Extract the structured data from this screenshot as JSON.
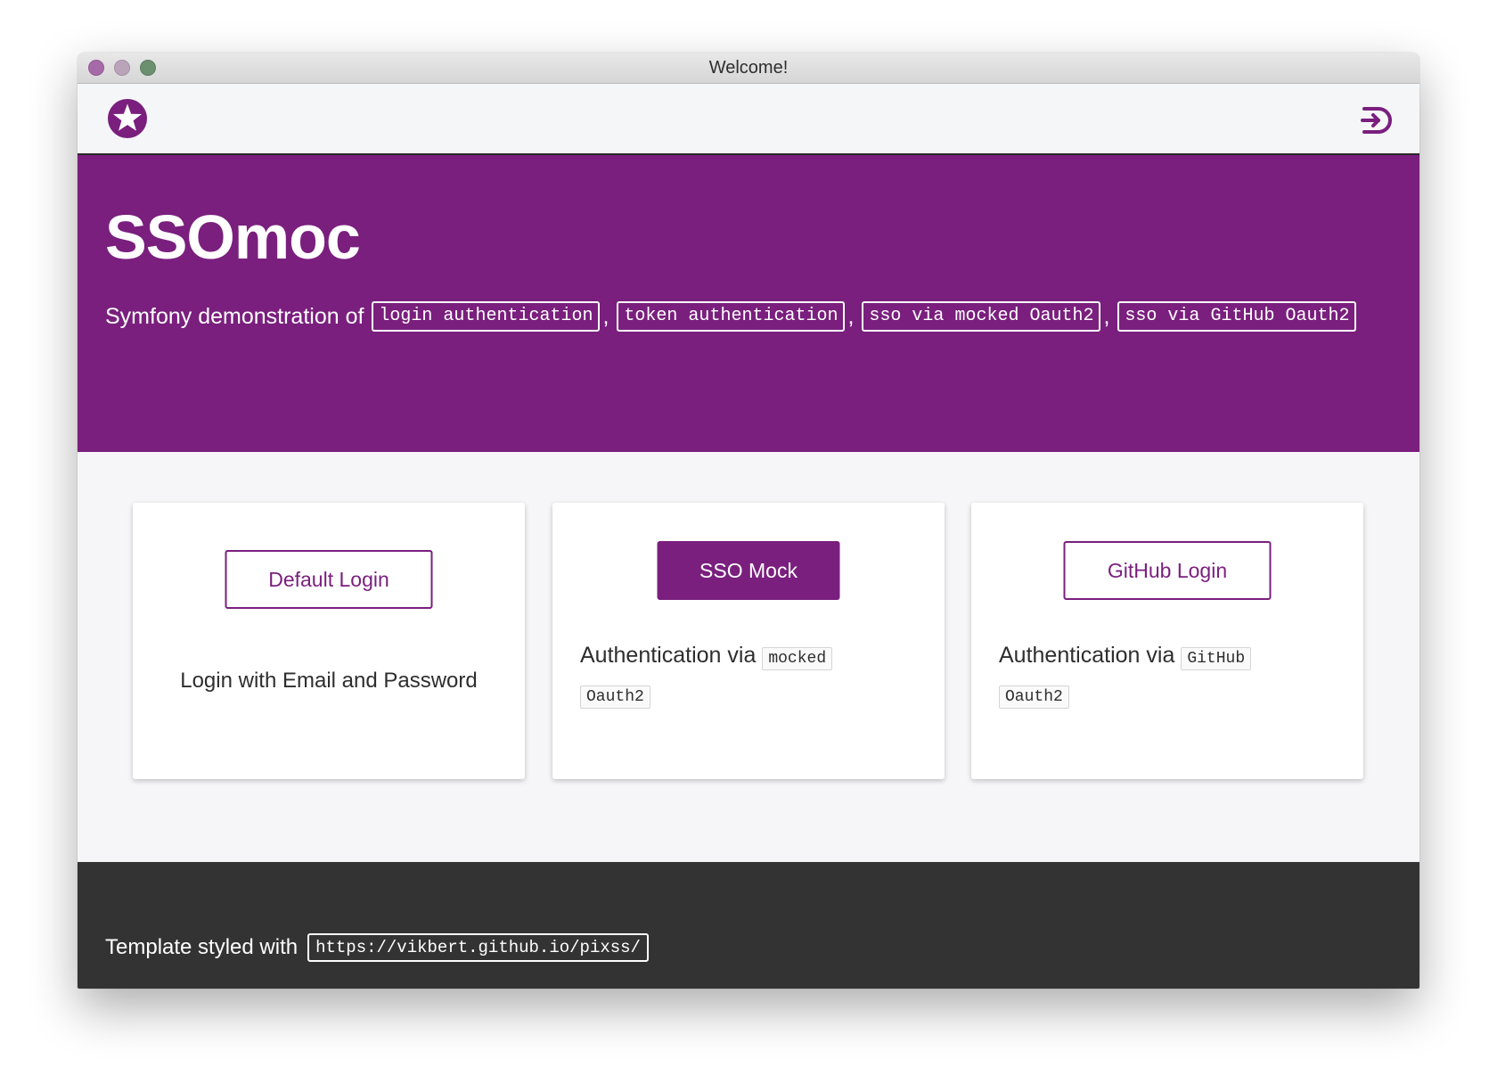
{
  "window": {
    "title": "Welcome!"
  },
  "navbar": {
    "logo_icon": "star-badge-icon",
    "logout_icon": "logout-icon"
  },
  "hero": {
    "title": "SSOmoc",
    "intro": "Symfony demonstration of",
    "tags": [
      "login authentication",
      "token authentication",
      "sso via mocked Oauth2",
      "sso via GitHub Oauth2"
    ],
    "separator": ","
  },
  "cards": [
    {
      "button_label": "Default Login",
      "description": "Login with Email and Password"
    },
    {
      "button_label": "SSO Mock",
      "description_prefix": "Authentication via",
      "code_1": "mocked",
      "code_2": "Oauth2"
    },
    {
      "button_label": "GitHub Login",
      "description_prefix": "Authentication via",
      "code_1": "GitHub",
      "code_2": "Oauth2"
    }
  ],
  "footer": {
    "text": "Template styled with",
    "link": "https://vikbert.github.io/pixss/"
  },
  "colors": {
    "brand": "#7a1f7e",
    "footer_bg": "#333333",
    "page_bg": "#f6f6f8"
  }
}
